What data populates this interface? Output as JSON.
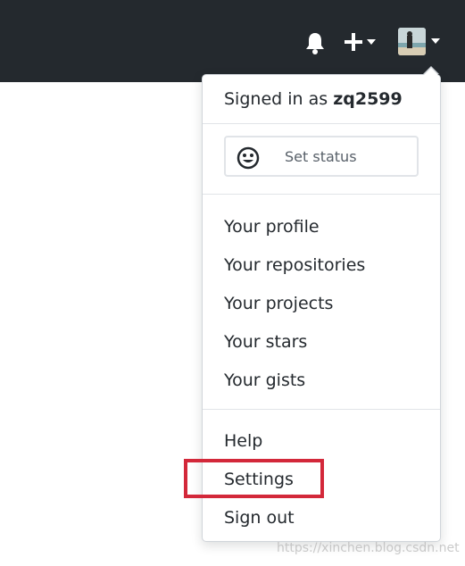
{
  "header": {
    "icons": [
      "bell-icon",
      "plus-icon",
      "caret-down-icon",
      "avatar"
    ]
  },
  "dropdown": {
    "signed_in_prefix": "Signed in as",
    "username": "zq2599",
    "set_status_label": "Set status",
    "items_group1": [
      "Your profile",
      "Your repositories",
      "Your projects",
      "Your stars",
      "Your gists"
    ],
    "items_group2": [
      "Help",
      "Settings",
      "Sign out"
    ]
  },
  "annotation": {
    "highlight_color": "#d3283a",
    "highlighted_item": "Settings"
  },
  "watermark": "https://xinchen.blog.csdn.net"
}
